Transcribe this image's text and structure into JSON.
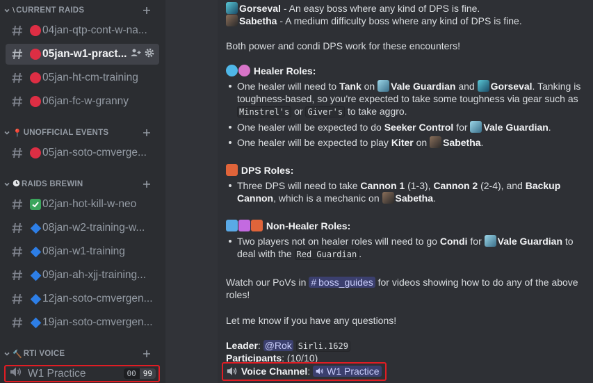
{
  "sidebar": {
    "categories": {
      "current_raids": "CURRENT RAIDS",
      "unofficial_events": "UNOFFICIAL EVENTS",
      "raids_brewin": "RAIDS BREWIN",
      "rti_voice": "RTI VOICE"
    },
    "channels": [
      {
        "name": "04jan-qtp-cont-w-na...",
        "status": "red"
      },
      {
        "name": "05jan-w1-pract...",
        "status": "red",
        "selected": true
      },
      {
        "name": "05jan-ht-cm-training",
        "status": "red"
      },
      {
        "name": "06jan-fc-w-granny",
        "status": "red"
      },
      {
        "name": "05jan-soto-cmverge...",
        "status": "red"
      },
      {
        "name": "02jan-hot-kill-w-neo",
        "status": "check"
      },
      {
        "name": "08jan-w2-training-w...",
        "status": "diamond"
      },
      {
        "name": "08jan-w1-training",
        "status": "diamond"
      },
      {
        "name": "09jan-ah-xjj-training...",
        "status": "diamond"
      },
      {
        "name": "12jan-soto-cmvergen...",
        "status": "diamond"
      },
      {
        "name": "19jan-soto-cmvergen...",
        "status": "diamond"
      }
    ],
    "voice": {
      "name": "W1 Practice",
      "count_left": "00",
      "count_right": "99"
    }
  },
  "message": {
    "gorseval_name": "Gorseval",
    "gorseval_desc": " - An easy boss where any kind of DPS is fine.",
    "sabetha_name": "Sabetha",
    "sabetha_desc": " - A medium difficulty boss where any kind of DPS is fine.",
    "both_dps": "Both power and condi DPS work for these encounters!",
    "healer_roles": "Healer Roles:",
    "h1_a": "One healer will need to ",
    "h1_tank": "Tank",
    "h1_on": " on ",
    "h1_vg": "Vale Guardian",
    "h1_and": " and ",
    "h1_gors": "Gorseval",
    "h1_b": ". Tanking is",
    "h1_c": "toughness-based, so you're expected to take some toughness via gear such as",
    "h1_minstrel": "Minstrel's",
    "h1_or": " or ",
    "h1_giver": "Giver's",
    "h1_d": " to take aggro.",
    "h2_a": "One healer will be expected to do ",
    "h2_seeker": "Seeker Control",
    "h2_for": " for ",
    "h2_vg": "Vale Guardian",
    "h2_end": ".",
    "h3_a": "One healer will be expected to play ",
    "h3_kiter": "Kiter",
    "h3_on": " on ",
    "h3_sab": "Sabetha",
    "h3_end": ".",
    "dps_roles": "DPS Roles:",
    "d1_a": "Three DPS will need to take ",
    "d1_c1": "Cannon 1",
    "d1_b": " (1-3), ",
    "d1_c2": "Cannon 2",
    "d1_c": " (2-4), and ",
    "d1_backup": "Backup",
    "d1_cannon": "Cannon",
    "d1_d": ", which is a mechanic on ",
    "d1_sab": "Sabetha",
    "d1_end": ".",
    "nonhealer_roles": "Non-Healer Roles:",
    "n1_a": "Two players not on healer roles will need to go ",
    "n1_condi": "Condi",
    "n1_for": " for ",
    "n1_vg": "Vale Guardian",
    "n1_to": " to",
    "n1_b": "deal with the ",
    "n1_red": "Red Guardian",
    "n1_end": ".",
    "povs_a": "Watch our PoVs in ",
    "povs_channel": "boss_guides",
    "povs_b": " for videos showing how to do any of the above",
    "povs_c": "roles!",
    "questions": "Let me know if you have any questions!",
    "leader_label": "Leader",
    "leader_colon": ": ",
    "leader_mention": "@Rok",
    "leader_account": "Sirli.1629",
    "participants_label": "Participants",
    "participants_value": ": (10/10)",
    "voice_label": "Voice Channel",
    "voice_colon": ": ",
    "voice_channel": "W1 Practice"
  },
  "colors": {
    "sidebar_bg": "#2b2d31",
    "main_bg": "#2e3035",
    "highlight_red": "#e11d24",
    "mention_blue": "#5865f2"
  }
}
